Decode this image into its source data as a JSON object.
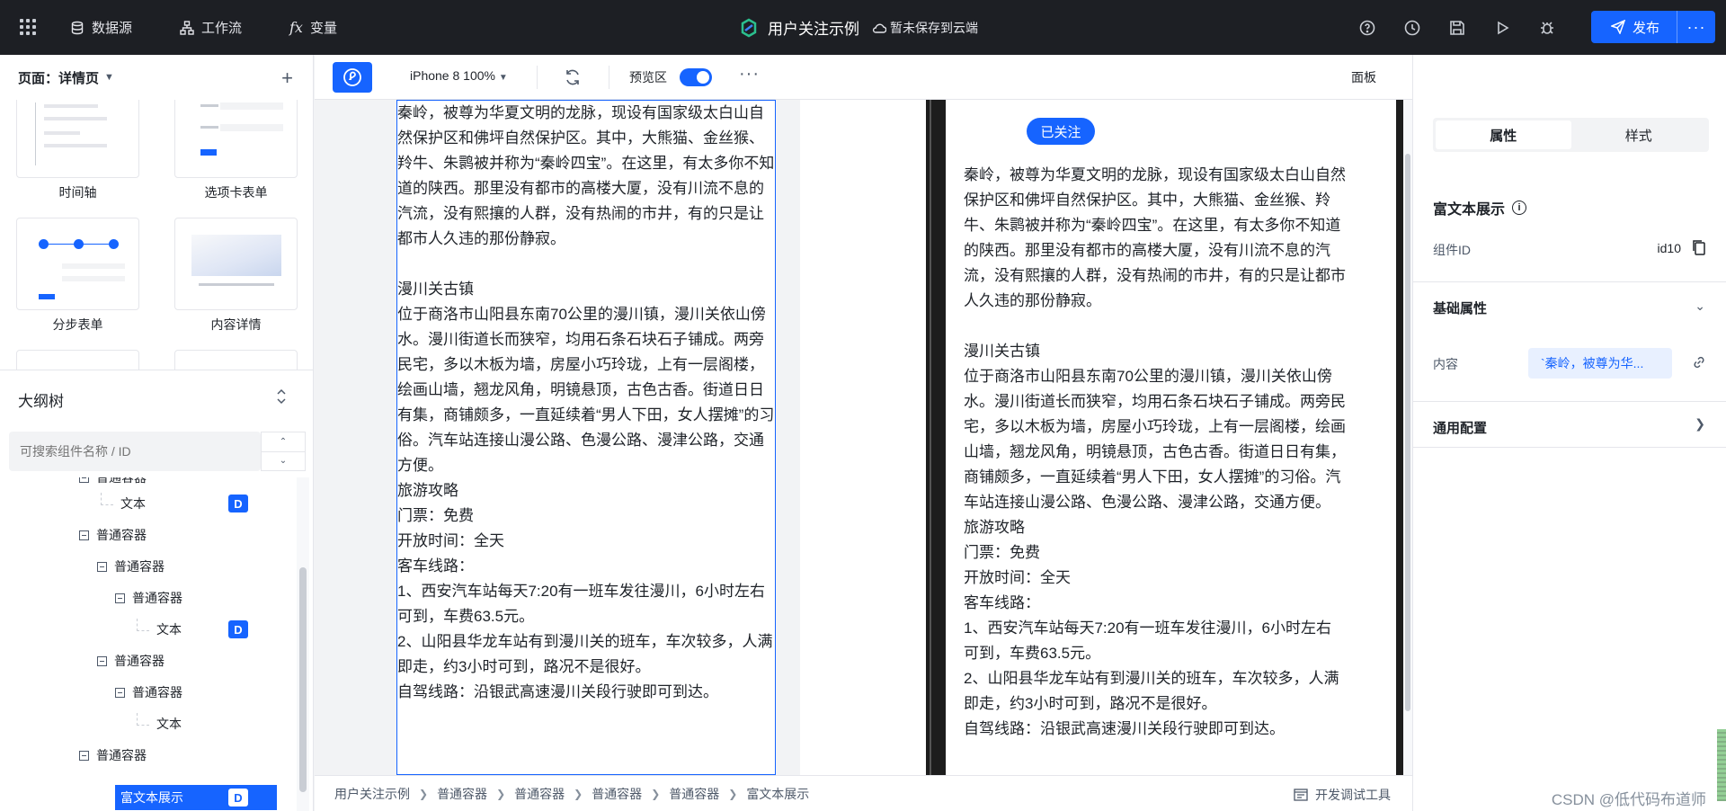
{
  "topbar": {
    "menu": [
      {
        "label": "数据源",
        "icon": "database-icon"
      },
      {
        "label": "工作流",
        "icon": "workflow-icon"
      },
      {
        "label": "变量",
        "icon": "function-icon"
      }
    ],
    "app_title": "用户关注示例",
    "save_state": "暂未保存到云端",
    "tools": [
      "help-icon",
      "history-icon",
      "save-icon",
      "play-icon",
      "debug-icon"
    ],
    "publish_label": "发布",
    "publish_more": "···"
  },
  "left": {
    "page_label": "页面：详情页",
    "components": [
      {
        "label": "时间轴"
      },
      {
        "label": "选项卡表单"
      },
      {
        "label": "分步表单"
      },
      {
        "label": "内容详情"
      }
    ],
    "outline_title": "大纲树",
    "search_placeholder": "可搜索组件名称 / ID",
    "tree": [
      {
        "label": "普通容器",
        "depth": 1,
        "type": "container"
      },
      {
        "label": "文本",
        "depth": 2,
        "type": "leaf",
        "badge": "D"
      },
      {
        "label": "普通容器",
        "depth": 1,
        "type": "container"
      },
      {
        "label": "普通容器",
        "depth": 2,
        "type": "container"
      },
      {
        "label": "普通容器",
        "depth": 3,
        "type": "container"
      },
      {
        "label": "文本",
        "depth": 4,
        "type": "leaf",
        "badge": "D"
      },
      {
        "label": "普通容器",
        "depth": 2,
        "type": "container"
      },
      {
        "label": "普通容器",
        "depth": 3,
        "type": "container"
      },
      {
        "label": "文本",
        "depth": 4,
        "type": "leaf"
      },
      {
        "label": "普通容器",
        "depth": 1,
        "type": "container"
      },
      {
        "label": "富文本展示",
        "depth": 2,
        "type": "leaf",
        "badge": "D",
        "selected": true
      }
    ]
  },
  "canvas_toolbar": {
    "device": "iPhone 8 100%",
    "preview_label": "预览区",
    "more": "···",
    "panel_label": "面板"
  },
  "canvas": {
    "followed_label": "已关注",
    "edit_text": "秦岭，被尊为华夏文明的龙脉，现设有国家级太白山自然保护区和佛坪自然保护区。其中，大熊猫、金丝猴、羚牛、朱鹮被并称为“秦岭四宝”。在这里，有太多你不知道的陕西。那里没有都市的高楼大厦，没有川流不息的汽流，没有熙攘的人群，没有热闹的市井，有的只是让都市人久违的那份静寂。\n\n漫川关古镇\n位于商洛市山阳县东南70公里的漫川镇，漫川关依山傍水。漫川街道长而狭窄，均用石条石块石子铺成。两旁民宅，多以木板为墙，房屋小巧玲珑，上有一层阁楼，绘画山墙，翘龙风角，明镜悬顶，古色古香。街道日日有集，商铺颇多，一直延续着“男人下田，女人摆摊”的习俗。汽车站连接山漫公路、色漫公路、漫津公路，交通方便。\n旅游攻略\n门票：免费\n开放时间：全天\n客车线路：\n1、西安汽车站每天7:20有一班车发往漫川，6小时左右可到，车费63.5元。\n2、山阳县华龙车站有到漫川关的班车，车次较多，人满即走，约3小时可到，路况不是很好。\n自驾线路：沿银武高速漫川关段行驶即可到达。",
    "preview_text": "秦岭，被尊为华夏文明的龙脉，现设有国家级太白山自然保护区和佛坪自然保护区。其中，大熊猫、金丝猴、羚牛、朱鹮被并称为“秦岭四宝”。在这里，有太多你不知道的陕西。那里没有都市的高楼大厦，没有川流不息的汽流，没有熙攘的人群，没有热闹的市井，有的只是让都市人久违的那份静寂。\n\n漫川关古镇\n位于商洛市山阳县东南70公里的漫川镇，漫川关依山傍水。漫川街道长而狭窄，均用石条石块石子铺成。两旁民宅，多以木板为墙，房屋小巧玲珑，上有一层阁楼，绘画山墙，翘龙风角，明镜悬顶，古色古香。街道日日有集，商铺颇多，一直延续着“男人下田，女人摆摊”的习俗。汽车站连接山漫公路、色漫公路、漫津公路，交通方便。\n旅游攻略\n门票：免费\n开放时间：全天\n客车线路：\n1、西安汽车站每天7:20有一班车发往漫川，6小时左右可到，车费63.5元。\n2、山阳县华龙车站有到漫川关的班车，车次较多，人满即走，约3小时可到，路况不是很好。\n自驾线路：沿银武高速漫川关段行驶即可到达。"
  },
  "breadcrumb": [
    "用户关注示例",
    "普通容器",
    "普通容器",
    "普通容器",
    "普通容器",
    "富文本展示"
  ],
  "dev_tools_label": "开发调试工具",
  "right": {
    "tabs": [
      "属性",
      "样式"
    ],
    "component_title": "富文本展示",
    "id_label": "组件ID",
    "id_value": "id10",
    "basic_section": "基础属性",
    "content_label": "内容",
    "content_value": "`秦岭，被尊为华...",
    "general_section": "通用配置"
  },
  "watermark": "CSDN @低代码布道师",
  "colors": {
    "accent": "#1664ff",
    "topbar": "#1d1f24"
  }
}
